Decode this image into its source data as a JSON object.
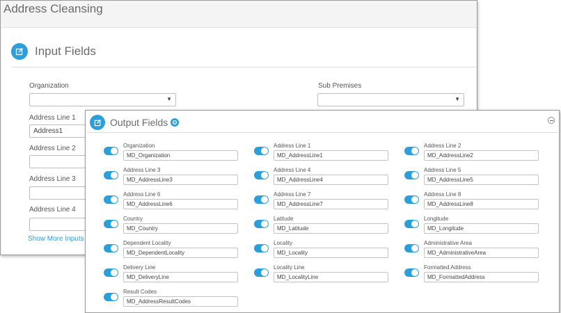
{
  "app": {
    "title": "Address Cleansing"
  },
  "input_fields": {
    "title": "Input Fields",
    "organization": {
      "label": "Organization",
      "value": ""
    },
    "sub_premises": {
      "label": "Sub Premises",
      "value": ""
    },
    "address_line_1": {
      "label": "Address Line 1",
      "value": "Address1"
    },
    "address_line_2": {
      "label": "Address Line 2",
      "value": ""
    },
    "address_line_3": {
      "label": "Address Line 3",
      "value": ""
    },
    "address_line_4": {
      "label": "Address Line 4",
      "value": ""
    },
    "show_more": "Show More Inputs"
  },
  "output_fields": {
    "title": "Output Fields",
    "items": [
      {
        "label": "Organization",
        "value": "MD_Organization",
        "enabled": true
      },
      {
        "label": "Address Line 1",
        "value": "MD_AddressLine1",
        "enabled": true
      },
      {
        "label": "Address Line 2",
        "value": "MD_AddressLine2",
        "enabled": true
      },
      {
        "label": "Address Line 3",
        "value": "MD_AddressLine3",
        "enabled": true
      },
      {
        "label": "Address Line 4",
        "value": "MD_AddressLine4",
        "enabled": true
      },
      {
        "label": "Address Line 5",
        "value": "MD_AddressLine5",
        "enabled": true
      },
      {
        "label": "Address Line 6",
        "value": "MD_AddressLine6",
        "enabled": true
      },
      {
        "label": "Address Line 7",
        "value": "MD_AddressLine7",
        "enabled": true
      },
      {
        "label": "Address Line 8",
        "value": "MD_AddressLine8",
        "enabled": true
      },
      {
        "label": "Country",
        "value": "MD_Country",
        "enabled": true
      },
      {
        "label": "Latitude",
        "value": "MD_Latitude",
        "enabled": true
      },
      {
        "label": "Longitude",
        "value": "MD_Longitude",
        "enabled": true
      },
      {
        "label": "Dependent Locality",
        "value": "MD_DependentLocality",
        "enabled": true
      },
      {
        "label": "Locality",
        "value": "MD_Locality",
        "enabled": true
      },
      {
        "label": "Administrative Area",
        "value": "MD_AdministrativeArea",
        "enabled": true
      },
      {
        "label": "Delivery Line",
        "value": "MD_DeliveryLine",
        "enabled": true
      },
      {
        "label": "Locality Line",
        "value": "MD_LocalityLine",
        "enabled": true
      },
      {
        "label": "Formatted Address",
        "value": "MD_FormattedAddress",
        "enabled": true
      },
      {
        "label": "Result Codes",
        "value": "MD_AddressResultCodes",
        "enabled": true
      }
    ]
  },
  "colors": {
    "accent": "#2b9fd9",
    "text": "#555555",
    "border": "#bdbdbd"
  },
  "icons": {
    "panel": "edit-icon",
    "settings": "gear-icon",
    "collapse": "collapse-icon"
  }
}
